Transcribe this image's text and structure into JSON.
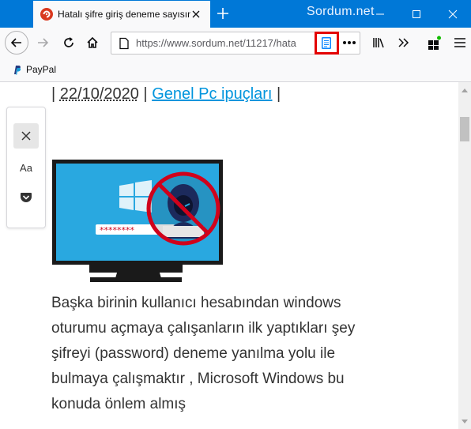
{
  "window": {
    "watermark": "Sordum.net",
    "accent_color": "#0078d7"
  },
  "tab": {
    "title": "Hatalı şifre giriş deneme sayısını",
    "favicon": "sordum-favicon"
  },
  "navbar": {
    "url": "https://www.sordum.net/11217/hata",
    "reader_view_icon": "reader-view-icon"
  },
  "bookmarks": {
    "items": [
      {
        "label": "PayPal",
        "icon": "paypal-icon"
      }
    ]
  },
  "article": {
    "meta_prefix": "| ",
    "date": "22/10/2020",
    "meta_sep": " | ",
    "category": "Genel Pc ipuçları",
    "meta_suffix": " |",
    "password_mask": "********",
    "body": "Başka birinin kullanıcı hesabından windows oturumu açmaya çalışanların ilk yaptıkları şey şifreyi (password) deneme yanılma yolu ile bulmaya çalışmaktır , Microsoft Windows bu konuda önlem almış"
  },
  "reader_toolbar": {
    "type_controls_label": "Aa"
  }
}
